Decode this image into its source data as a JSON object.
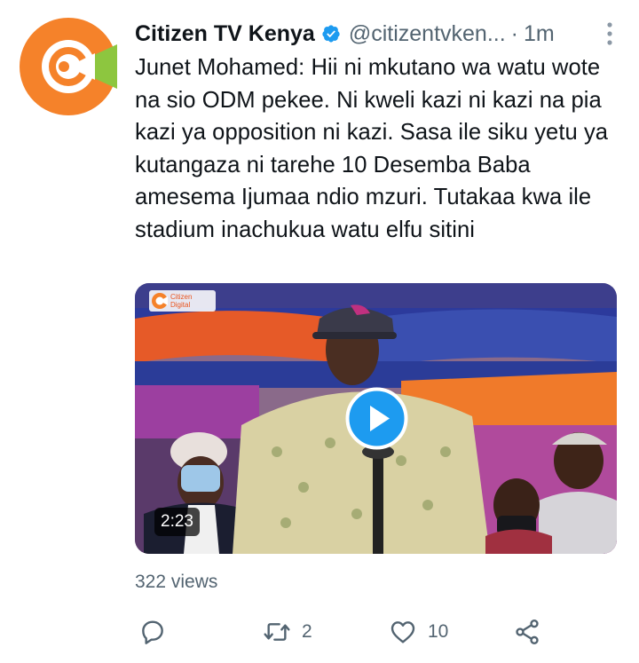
{
  "tweet": {
    "author_name": "Citizen TV Kenya",
    "handle": "@citizentvken...",
    "separator": "·",
    "time": "1m",
    "text": "Junet Mohamed: Hii ni mkutano wa watu wote na sio ODM pekee. Ni kweli kazi ni kazi na pia kazi ya opposition ni kazi. Sasa ile siku yetu ya kutangaza ni tarehe 10 Desemba Baba amesema Ijumaa ndio mzuri. Tutakaa kwa ile stadium inachukua watu elfu sitini",
    "media": {
      "type": "video",
      "duration": "2:23",
      "watermark": "Citizen Digital"
    },
    "views": "322 views"
  },
  "actions": {
    "reply_icon": "reply-icon",
    "retweet_count": "2",
    "like_count": "10",
    "share_icon": "share-icon"
  },
  "colors": {
    "accent": "#1d9bf0",
    "muted": "#536471",
    "text": "#0f1419",
    "brand_orange": "#f5822a",
    "brand_green": "#8dc63f"
  }
}
